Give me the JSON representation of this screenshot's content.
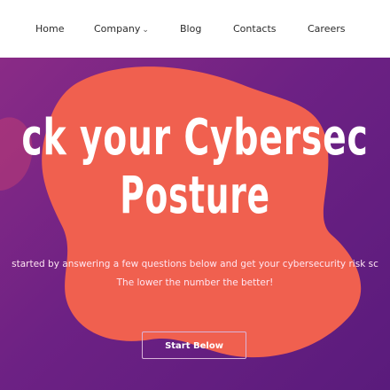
{
  "nav": {
    "items": [
      {
        "label": "Home"
      },
      {
        "label": "Company",
        "has_dropdown": true
      },
      {
        "label": "Blog"
      },
      {
        "label": "Contacts"
      },
      {
        "label": "Careers"
      }
    ],
    "dropdown_icon": "chevron-down-icon"
  },
  "hero": {
    "headline_line1": "ck your Cybersec",
    "headline_line2": "Posture",
    "subtext_line1": "started by answering a few questions below and get your cybersecurity risk sc",
    "subtext_line2": "The lower the number the better!",
    "cta_label": "Start Below"
  },
  "colors": {
    "hero_bg": "#6d2184",
    "blob": "#f0604f",
    "blob_light": "#f47a55",
    "cta_border": "#d9b3d9"
  }
}
